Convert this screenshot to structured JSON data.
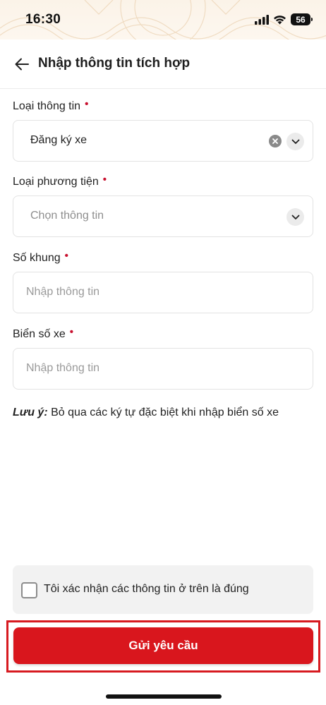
{
  "status_bar": {
    "time": "16:30",
    "battery": "56",
    "icons": [
      "cellular-signal-icon",
      "wifi-icon",
      "battery-icon"
    ]
  },
  "header": {
    "title": "Nhập thông tin tích hợp",
    "back_icon": "arrow-left-icon"
  },
  "form": {
    "info_type": {
      "label": "Loại thông tin",
      "required_mark": "•",
      "value": "Đăng ký xe"
    },
    "vehicle_type": {
      "label": "Loại phương tiện",
      "required_mark": "•",
      "placeholder": "Chọn thông tin"
    },
    "frame_number": {
      "label": "Số khung",
      "required_mark": "•",
      "placeholder": "Nhập thông tin"
    },
    "plate_number": {
      "label": "Biển số xe",
      "required_mark": "•",
      "placeholder": "Nhập thông tin"
    }
  },
  "note": {
    "prefix": "Lưu ý:",
    "text": " Bỏ qua các ký tự đặc biệt khi nhập biển số xe"
  },
  "confirm": {
    "label": "Tôi xác nhận các thông tin ở trên là đúng",
    "checked": false
  },
  "submit": {
    "label": "Gửi yêu cầu"
  },
  "colors": {
    "accent": "#d9161d",
    "required": "#c8102e",
    "highlight": "#d71a20"
  }
}
